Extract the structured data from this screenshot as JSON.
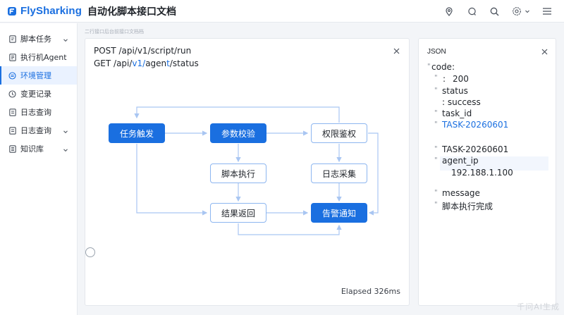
{
  "header": {
    "brand": "FlySharking",
    "title": "自动化脚本接口文档",
    "icons": [
      "location-icon",
      "chat-icon",
      "search-icon",
      "settings-icon",
      "menu-icon"
    ]
  },
  "sidebar": {
    "items": [
      {
        "label": "脚本任务",
        "icon": "script-icon",
        "has_chevron": true
      },
      {
        "label": "执行机Agent",
        "icon": "agent-icon",
        "has_chevron": false
      },
      {
        "label": "环境管理",
        "icon": "env-icon",
        "has_chevron": false,
        "active": true
      },
      {
        "label": "变更记录",
        "icon": "record-icon",
        "has_chevron": false
      },
      {
        "label": "日志查询",
        "icon": "log-icon",
        "has_chevron": false
      },
      {
        "label": "日志查询",
        "icon": "log-icon",
        "has_chevron": true
      },
      {
        "label": "知识库",
        "icon": "book-icon",
        "has_chevron": true
      }
    ]
  },
  "breadcrumb": "二行接口后台前接口文档档",
  "main": {
    "api_line1": "POST /api/v1/script/run",
    "api_line2": {
      "prefix": "GET /api/",
      "hl1": "v1/",
      "mid": "agen",
      "hl2": "t",
      "suffix": "/status"
    },
    "nodes": {
      "trigger": "任务触发",
      "validate": "参数校验",
      "auth": "权限鉴权",
      "exec": "脚本执行",
      "collect": "日志采集",
      "result": "结果返回",
      "notify": "告警通知"
    },
    "elapsed": "Elapsed 326ms"
  },
  "json_panel": {
    "title": "JSON",
    "lines": {
      "code_key": "code:",
      "code_colon": ":",
      "code_val": "200",
      "status_key": "status",
      "status_val": ": success",
      "task_key": "task_id",
      "task_val1": "TASK-20260601",
      "task_val2": "TASK-20260601",
      "agent_key": "agent_ip",
      "agent_val": "192.188.1.100",
      "msg_key": "message",
      "msg_val": "脚本执行完成"
    }
  },
  "watermark": "千问AI生成",
  "colors": {
    "accent": "#1a6fe0",
    "node_border": "#8db6f0",
    "edge": "#a9c6f2"
  }
}
